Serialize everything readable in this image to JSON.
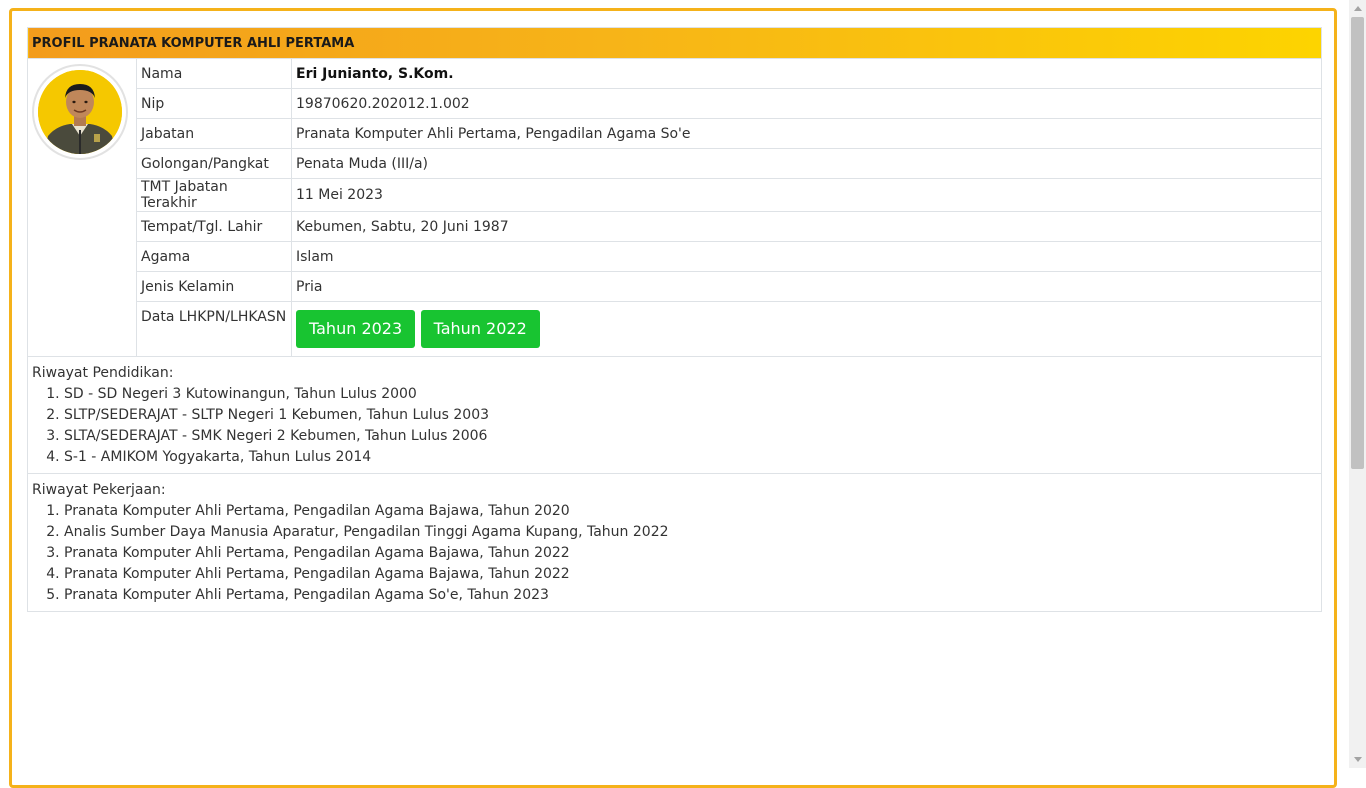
{
  "header": {
    "title": "PROFIL PRANATA KOMPUTER AHLI PERTAMA"
  },
  "profile": {
    "rows": [
      {
        "label": "Nama",
        "value": "Eri Junianto, S.Kom."
      },
      {
        "label": "Nip",
        "value": "19870620.202012.1.002"
      },
      {
        "label": "Jabatan",
        "value": "Pranata Komputer Ahli Pertama, Pengadilan Agama So'e"
      },
      {
        "label": "Golongan/Pangkat",
        "value": "Penata Muda (III/a)"
      },
      {
        "label": "TMT Jabatan Terakhir",
        "value": "11 Mei 2023"
      },
      {
        "label": "Tempat/Tgl. Lahir",
        "value": "Kebumen, Sabtu, 20 Juni 1987"
      },
      {
        "label": "Agama",
        "value": "Islam"
      },
      {
        "label": "Jenis Kelamin",
        "value": "Pria"
      }
    ],
    "lhkpn": {
      "label": "Data LHKPN/LHKASN",
      "buttons": [
        "Tahun 2023",
        "Tahun 2022"
      ]
    }
  },
  "pendidikan": {
    "title": "Riwayat Pendidikan:",
    "items": [
      "SD - SD Negeri 3 Kutowinangun, Tahun Lulus 2000",
      "SLTP/SEDERAJAT - SLTP Negeri 1 Kebumen, Tahun Lulus 2003",
      "SLTA/SEDERAJAT - SMK Negeri 2 Kebumen, Tahun Lulus 2006",
      "S-1 - AMIKOM Yogyakarta, Tahun Lulus 2014"
    ]
  },
  "pekerjaan": {
    "title": "Riwayat Pekerjaan:",
    "items": [
      "Pranata Komputer Ahli Pertama, Pengadilan Agama Bajawa, Tahun 2020",
      "Analis Sumber Daya Manusia Aparatur, Pengadilan Tinggi Agama Kupang, Tahun 2022",
      "Pranata Komputer Ahli Pertama, Pengadilan Agama Bajawa, Tahun 2022",
      "Pranata Komputer Ahli Pertama, Pengadilan Agama Bajawa, Tahun 2022",
      "Pranata Komputer Ahli Pertama, Pengadilan Agama So'e, Tahun 2023"
    ]
  },
  "colors": {
    "frame_border": "#f5b21a",
    "header_gradient_start": "#f39c1c",
    "header_gradient_end": "#fdd400",
    "button_green": "#18c431"
  }
}
